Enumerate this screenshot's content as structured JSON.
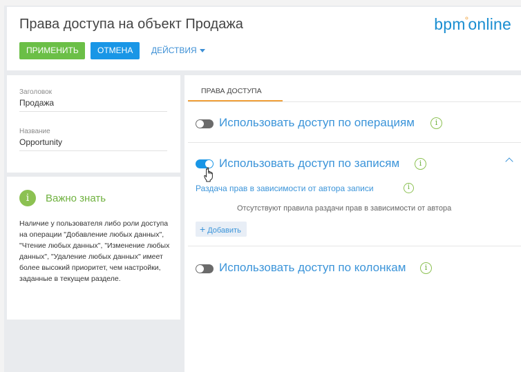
{
  "header": {
    "title": "Права доступа на объект Продажа",
    "logo_main": "bpm",
    "logo_rest": "online",
    "apply_label": "Применить",
    "cancel_label": "Отмена",
    "actions_label": "Действия"
  },
  "fields": [
    {
      "label": "Заголовок",
      "value": "Продажа"
    },
    {
      "label": "Название",
      "value": "Opportunity"
    }
  ],
  "info": {
    "icon": "i",
    "title": "Важно знать",
    "text": "Наличие у пользователя либо роли доступа на операции \"Добавление любых данных\", \"Чтение любых данных\", \"Изменение любых данных\", \"Удаление любых данных\" имеет более высокий приоритет, чем настройки, заданные в текущем разделе."
  },
  "tabs": [
    {
      "label": "Права доступа"
    }
  ],
  "sections": {
    "operations": {
      "label": "Использовать доступ по операциям",
      "enabled": false
    },
    "records": {
      "label": "Использовать доступ по записям",
      "enabled": true,
      "subsection_label": "Раздача прав в зависимости от автора записи",
      "empty_message": "Отсутствуют правила раздачи прав в зависимости от автора",
      "add_label": "Добавить"
    },
    "columns": {
      "label": "Использовать доступ по колонкам",
      "enabled": false
    }
  },
  "hint_icon": "i",
  "colors": {
    "accent_blue": "#1996e6",
    "apply_green": "#6bbf47",
    "info_green": "#8cc152",
    "tab_underline": "#f1a13a"
  },
  "icons": {
    "logo_dot": "°",
    "plus": "+",
    "actions_caret": "chevron-down-icon",
    "collapse": "chevron-up-icon",
    "cursor": "hand-pointer-icon"
  }
}
